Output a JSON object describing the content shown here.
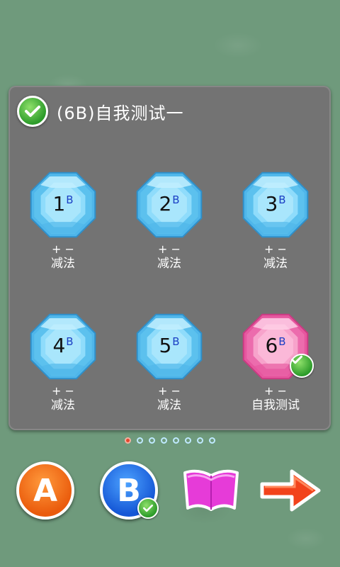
{
  "header": {
    "title": "(6B)自我测试一"
  },
  "colors": {
    "gem_blue": "#7fd3f7",
    "gem_pink": "#f48cc0",
    "accent_green": "#2c9b2a"
  },
  "gems": [
    {
      "number": "1",
      "superscript": "B",
      "ops": "+ −",
      "name": "减法",
      "color": "blue",
      "completed": false
    },
    {
      "number": "2",
      "superscript": "B",
      "ops": "+ −",
      "name": "减法",
      "color": "blue",
      "completed": false
    },
    {
      "number": "3",
      "superscript": "B",
      "ops": "+ −",
      "name": "减法",
      "color": "blue",
      "completed": false
    },
    {
      "number": "4",
      "superscript": "B",
      "ops": "+ −",
      "name": "减法",
      "color": "blue",
      "completed": false
    },
    {
      "number": "5",
      "superscript": "B",
      "ops": "+ −",
      "name": "减法",
      "color": "blue",
      "completed": false
    },
    {
      "number": "6",
      "superscript": "B",
      "ops": "+ −",
      "name": "自我测试",
      "color": "pink",
      "completed": true
    }
  ],
  "pagination": {
    "total": 8,
    "current": 1
  },
  "bottom": {
    "a_label": "A",
    "b_label": "B",
    "b_completed": true,
    "book_icon": "book-icon",
    "next_icon": "arrow-right-icon"
  }
}
